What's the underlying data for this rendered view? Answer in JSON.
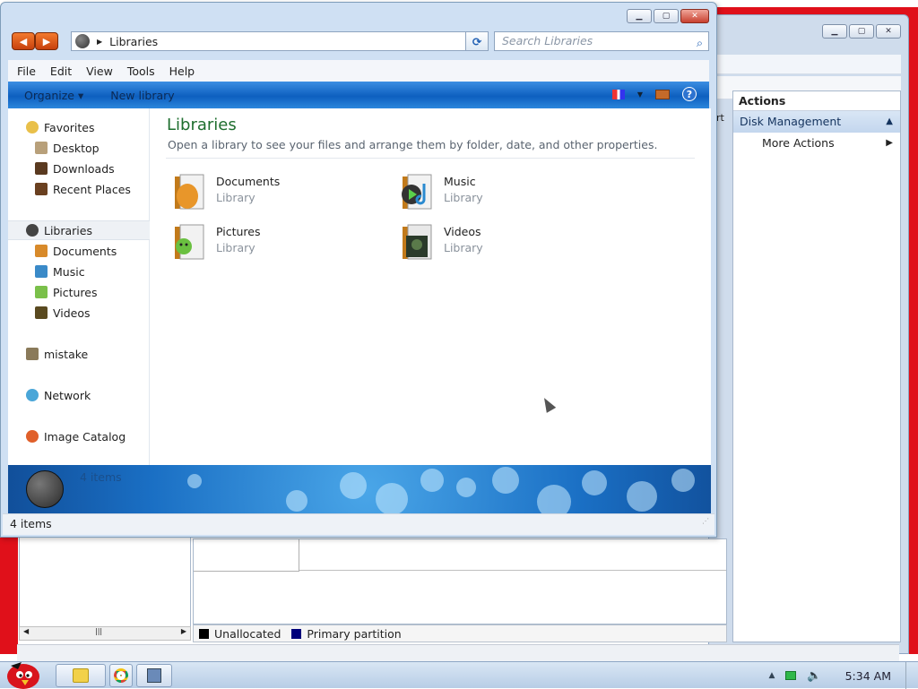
{
  "explorer": {
    "address": "Libraries",
    "search_placeholder": "Search Libraries",
    "menu": [
      "File",
      "Edit",
      "View",
      "Tools",
      "Help"
    ],
    "commands": {
      "organize": "Organize ▾",
      "new_library": "New library"
    },
    "nav": {
      "favorites": "Favorites",
      "favorites_items": [
        "Desktop",
        "Downloads",
        "Recent Places"
      ],
      "libraries": "Libraries",
      "libraries_items": [
        "Documents",
        "Music",
        "Pictures",
        "Videos"
      ],
      "homegroup": "mistake",
      "network": "Network",
      "catalog": "Image Catalog"
    },
    "content": {
      "title": "Libraries",
      "subtitle": "Open a library to see your files and arrange them by folder, date, and other properties.",
      "libraries": [
        {
          "name": "Documents",
          "type": "Library"
        },
        {
          "name": "Music",
          "type": "Library"
        },
        {
          "name": "Pictures",
          "type": "Library"
        },
        {
          "name": "Videos",
          "type": "Library"
        }
      ]
    },
    "details_count": "4 items",
    "status": "4 items"
  },
  "disk_mgmt": {
    "actions_header": "Actions",
    "selected_action": "Disk Management",
    "more_actions": "More Actions",
    "legend": {
      "unallocated": "Unallocated",
      "primary": "Primary partition"
    },
    "partial_text": "rt"
  },
  "taskbar": {
    "clock": "5:34 AM"
  },
  "colors": {
    "accent": "#1a6fc4",
    "title_green": "#1e6e2e",
    "legend_unallocated": "#000000",
    "legend_primary": "#00007a"
  }
}
